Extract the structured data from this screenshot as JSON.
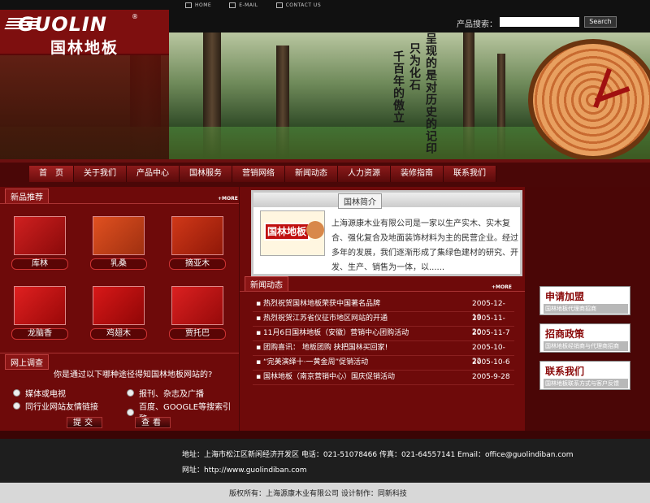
{
  "toplinks": [
    "HOME",
    "E-MAIL",
    "CONTACT US"
  ],
  "search": {
    "label": "产品搜索：",
    "value": "",
    "button": "Search"
  },
  "logo": {
    "en": "GUOLIN",
    "cn": "国林地板",
    "mark": "®"
  },
  "banner": {
    "text1": "千百年的傲立",
    "text2": "只为化石",
    "text3": "呈现的是对历史的记印"
  },
  "nav": [
    "首　页",
    "关于我们",
    "产品中心",
    "国林服务",
    "营销网络",
    "新闻动态",
    "人力资源",
    "装修指南",
    "联系我们"
  ],
  "products": {
    "title": "新品推荐",
    "more": "+MORE",
    "items": [
      {
        "label": "库林",
        "color": "#b8181c"
      },
      {
        "label": "乳桑",
        "color": "#c0361a"
      },
      {
        "label": "摘亚木",
        "color": "#a82010"
      },
      {
        "label": "龙脑香",
        "color": "#c01818"
      },
      {
        "label": "鸡翅木",
        "color": "#b01010"
      },
      {
        "label": "贾托巴",
        "color": "#b81414"
      }
    ]
  },
  "survey": {
    "title": "网上调查",
    "question": "你是通过以下哪种途径得知国林地板网站的?",
    "options": [
      "媒体或电视",
      "报刊、杂志及广播",
      "同行业网站友情链接",
      "百度、GOOGLE等搜索引擎"
    ],
    "submit": "提交",
    "view": "查看"
  },
  "intro": {
    "title": "国林简介",
    "badge": "国林地板",
    "text": "上海源康木业有限公司是一家以生产实木、实木复合、强化复合及地面装饰材料为主的民营企业。经过多年的发展，我们逐渐形成了集绿色建材的研究、开发、生产、销售为一体，以......"
  },
  "news": {
    "title": "新闻动态",
    "more": "+MORE",
    "items": [
      {
        "title": "▪ 热烈祝贺国林地板荣获中国著名品牌",
        "date": "2005-12-19"
      },
      {
        "title": "▪ 热烈祝贺江苏省仪征市地区网站的开通",
        "date": "2005-11-20"
      },
      {
        "title": "▪ 11月6日国林地板（安徽）营销中心团购活动",
        "date": "2005-11-7"
      },
      {
        "title": "▪ 团购喜讯： 地板团购 抉把国林买回家!",
        "date": "2005-10-22"
      },
      {
        "title": "▪ “完美演绎十·一黄金周”促销活动",
        "date": "2005-10-6"
      },
      {
        "title": "▪ 国林地板（南京营销中心）国庆促销活动",
        "date": "2005-9-28"
      }
    ]
  },
  "side": [
    {
      "title": "申请加盟",
      "sub": "国林地板代理商招商"
    },
    {
      "title": "招商政策",
      "sub": "国林地板经销商与代理商招商"
    },
    {
      "title": "联系我们",
      "sub": "国林地板联系方式与客户反馈"
    }
  ],
  "footer": {
    "address": "地址：上海市松江区新闲经济开发区  电话：021-51078466  传真：021-64557141  Email：office@guolindiban.com",
    "url": "网址：http://www.guolindiban.com",
    "copyright": "版权所有：上海源康木业有限公司  设计制作：同新科技"
  }
}
